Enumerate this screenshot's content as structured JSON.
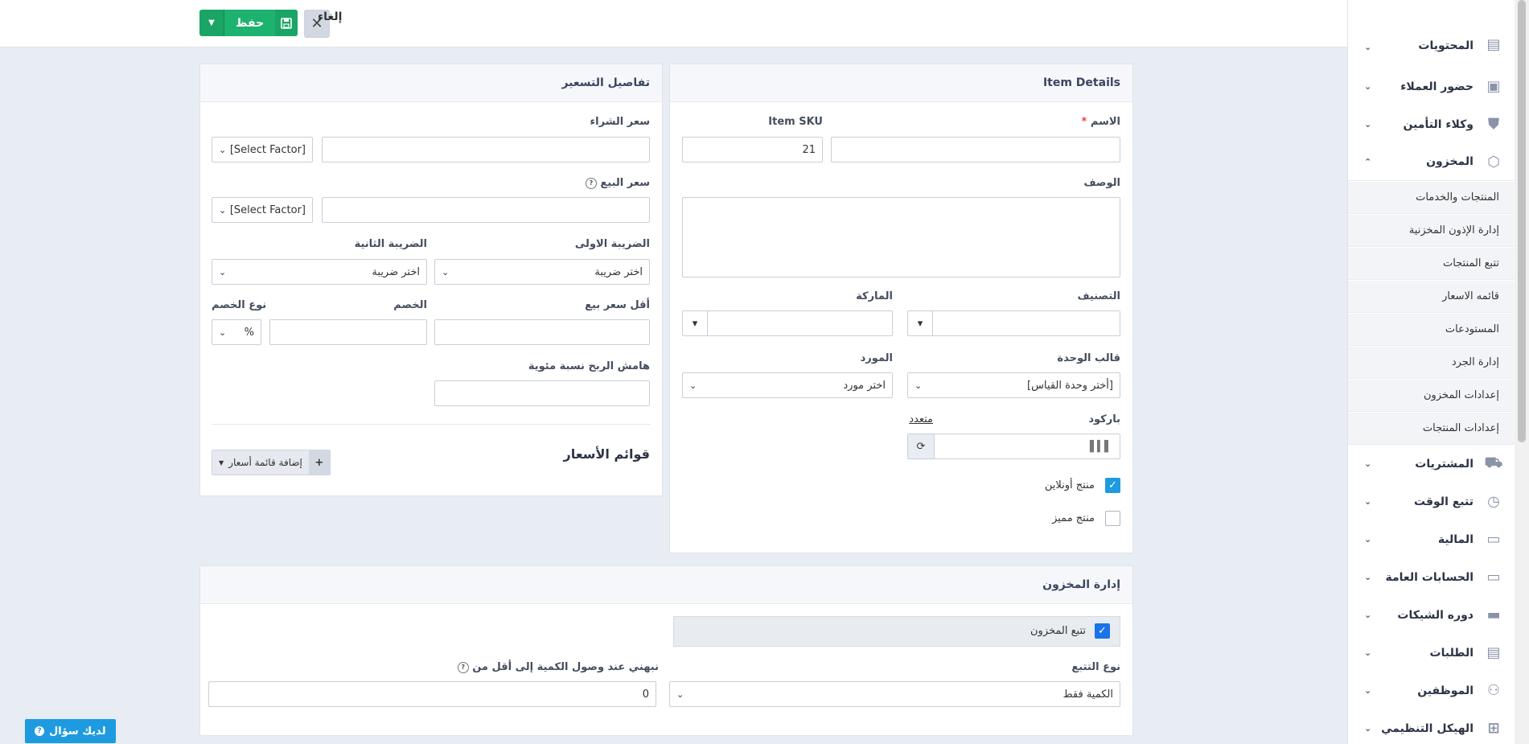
{
  "toolbar": {
    "save_label": "حفظ",
    "cancel_label": "إلغاء"
  },
  "item_details": {
    "title": "Item Details",
    "name_label": "الاسم",
    "required_mark": "*",
    "sku_label": "Item SKU",
    "sku_value": "21",
    "description_label": "الوصف",
    "category_label": "التصنيف",
    "brand_label": "الماركة",
    "unit_template_label": "قالب الوحدة",
    "unit_template_value": "[أختر وحدة القياس]",
    "supplier_label": "المورد",
    "supplier_value": "اختر مورد",
    "barcode_label": "باركود",
    "multiple_link": "متعدد",
    "online_product_label": "منتج أونلاين",
    "featured_product_label": "منتج مميز"
  },
  "pricing": {
    "title": "تفاصيل التسعير",
    "purchase_price_label": "سعر الشراء",
    "sale_price_label": "سعر البيع",
    "factor_placeholder": "[Select Factor]",
    "tax1_label": "الضريبة الاولى",
    "tax2_label": "الضريبة الثانية",
    "tax_placeholder": "اختر ضريبة",
    "min_price_label": "أقل سعر بيع",
    "discount_label": "الخصم",
    "discount_type_label": "نوع الخصم",
    "discount_type_value": "%",
    "profit_margin_label": "هامش الربح نسبة مئوية",
    "price_lists_title": "قوائم الأسعار",
    "add_price_list": "إضافة قائمة أسعار"
  },
  "inventory": {
    "title": "إدارة المخزون",
    "track_inventory_label": "تتبع المخزون",
    "tracking_type_label": "نوع التتبع",
    "tracking_type_value": "الكمية فقط",
    "notify_label": "نبهني عند وصول الكمية إلى أقل من",
    "notify_value": "0"
  },
  "sidebar": {
    "items": [
      {
        "label": "حضور العملاء",
        "icon": "calendar-user-icon"
      },
      {
        "label": "وكلاء التأمين",
        "icon": "shield-icon"
      },
      {
        "label": "المخزون",
        "icon": "box-icon"
      },
      {
        "label": "المشتريات",
        "icon": "truck-icon"
      },
      {
        "label": "تتبع الوقت",
        "icon": "calendar-clock-icon"
      },
      {
        "label": "المالية",
        "icon": "money-icon"
      },
      {
        "label": "الحسابات العامة",
        "icon": "accounts-icon"
      },
      {
        "label": "دوره الشيكات",
        "icon": "cheque-icon"
      },
      {
        "label": "الطلبات",
        "icon": "clipboard-icon"
      },
      {
        "label": "الموظفين",
        "icon": "users-icon"
      },
      {
        "label": "الهيكل التنظيمي",
        "icon": "org-chart-icon"
      }
    ],
    "top_partial": "المحتويات",
    "inventory_sub": [
      "المنتجات والخدمات",
      "إدارة الإذون المخزنية",
      "تتبع المنتجات",
      "قائمه الاسعار",
      "المستودعات",
      "إدارة الجرد",
      "إعدادات المخزون",
      "إعدادات المنتجات"
    ]
  },
  "help_button": "لديك سؤال",
  "colors": {
    "accent": "#1e9be0",
    "save": "#1eb270",
    "background": "#e8ecf3"
  }
}
